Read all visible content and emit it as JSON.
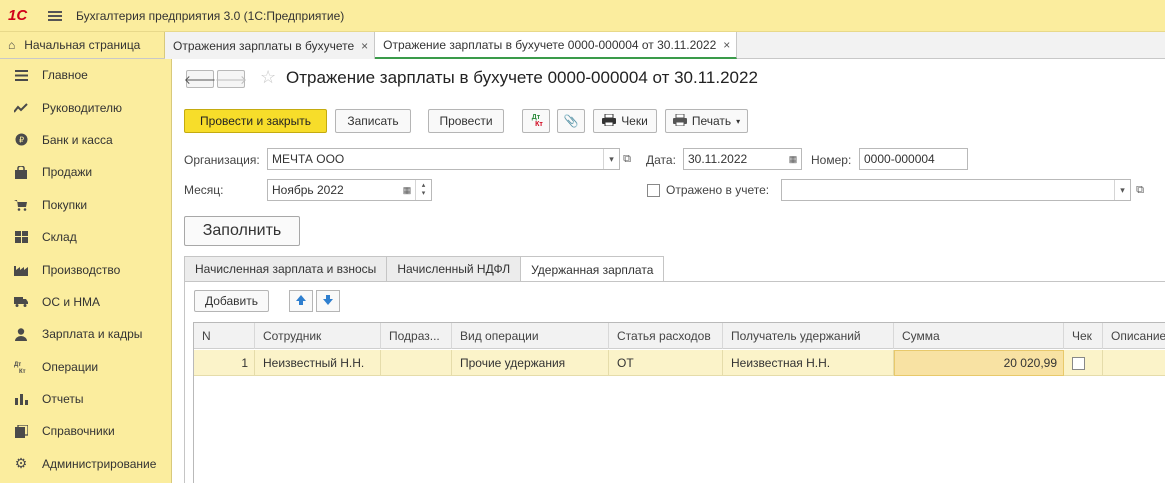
{
  "app": {
    "logo": "1С",
    "title": "Бухгалтерия предприятия 3.0  (1С:Предприятие)"
  },
  "tabs": {
    "home": "Начальная страница",
    "items": [
      {
        "label": "Отражения зарплаты в бухучете",
        "close": "×"
      },
      {
        "label": "Отражение зарплаты в бухучете 0000-000004 от 30.11.2022",
        "close": "×"
      }
    ]
  },
  "sidebar": {
    "items": [
      {
        "label": "Главное",
        "icon": "list-icon"
      },
      {
        "label": "Руководителю",
        "icon": "trend-icon"
      },
      {
        "label": "Банк и касса",
        "icon": "coin-icon"
      },
      {
        "label": "Продажи",
        "icon": "bag-icon"
      },
      {
        "label": "Покупки",
        "icon": "cart-icon"
      },
      {
        "label": "Склад",
        "icon": "warehouse-icon"
      },
      {
        "label": "Производство",
        "icon": "factory-icon"
      },
      {
        "label": "ОС и НМА",
        "icon": "truck-icon"
      },
      {
        "label": "Зарплата и кадры",
        "icon": "person-icon"
      },
      {
        "label": "Операции",
        "icon": "dt-kt-icon"
      },
      {
        "label": "Отчеты",
        "icon": "bar-chart-icon"
      },
      {
        "label": "Справочники",
        "icon": "books-icon"
      },
      {
        "label": "Администрирование",
        "icon": "gear-icon"
      }
    ]
  },
  "document": {
    "title": "Отражение зарплаты в бухучете 0000-000004 от 30.11.2022",
    "back": "🡐",
    "forward": "🡒",
    "star": "☆"
  },
  "toolbar": {
    "post_close": "Провести и закрыть",
    "save": "Записать",
    "post": "Провести",
    "dtkt_dt": "Дт",
    "dtkt_kt": "Кт",
    "attach": "📎",
    "checks": "Чеки",
    "print": "Печать"
  },
  "form": {
    "org_label": "Организация:",
    "org_value": "МЕЧТА ООО",
    "date_label": "Дата:",
    "date_value": "30.11.2022",
    "number_label": "Номер:",
    "number_value": "0000-000004",
    "month_label": "Месяц:",
    "month_value": "Ноябрь 2022",
    "reflected_label": "Отражено в учете:",
    "reflected_value": "",
    "fill_button": "Заполнить"
  },
  "form_tabs": [
    {
      "label": "Начисленная зарплата и взносы",
      "active": false
    },
    {
      "label": "Начисленный НДФЛ",
      "active": false
    },
    {
      "label": "Удержанная зарплата",
      "active": true
    }
  ],
  "table": {
    "add_button": "Добавить",
    "columns": [
      "N",
      "Сотрудник",
      "Подраз...",
      "Вид операции",
      "Статья расходов",
      "Получатель удержаний",
      "Сумма",
      "Чек",
      "Описание"
    ],
    "rows": [
      {
        "n": "1",
        "employee": "Неизвестный Н.Н.",
        "department": "",
        "operation": "Прочие удержания",
        "expense": "ОТ",
        "recipient": "Неизвестная Н.Н.",
        "amount": "20 020,99",
        "check": false,
        "description": ""
      }
    ]
  },
  "colors": {
    "sidebar_bg": "#fbed9e",
    "primary_button": "#f7dd2a",
    "row_highlight": "#fbf3c9",
    "active_tab_accent": "#3a9b4a"
  }
}
